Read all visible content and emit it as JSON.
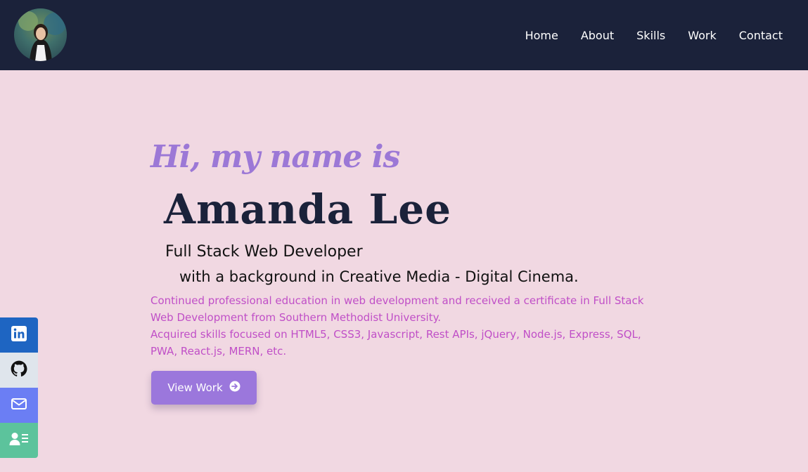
{
  "nav": {
    "links": [
      "Home",
      "About",
      "Skills",
      "Work",
      "Contact"
    ]
  },
  "hero": {
    "greeting": "Hi, my name is",
    "name": "Amanda Lee",
    "role": "Full Stack Web Developer",
    "background": "with a background in Creative Media - Digital Cinema.",
    "description": [
      "Continued professional education in web development and received a certificate in Full Stack Web Development from Southern Methodist University.",
      "Acquired skills focused on HTML5, CSS3, Javascript, Rest APIs, jQuery, Node.js, Express, SQL, PWA, React.js, MERN, etc."
    ],
    "cta_label": "View Work"
  },
  "social": {
    "items": [
      "linkedin-icon",
      "github-icon",
      "email-icon",
      "resume-icon"
    ]
  },
  "colors": {
    "navbar": "#1b223a",
    "page_background": "#f1d8e2",
    "greeting": "#9c78d6",
    "name": "#1b223a",
    "description": "#c04fc7",
    "button": "#9b77dc",
    "linkedin": "#1e65c2",
    "github": "#dfe5ec",
    "email": "#6b7ef4",
    "resume": "#5cc39c"
  }
}
